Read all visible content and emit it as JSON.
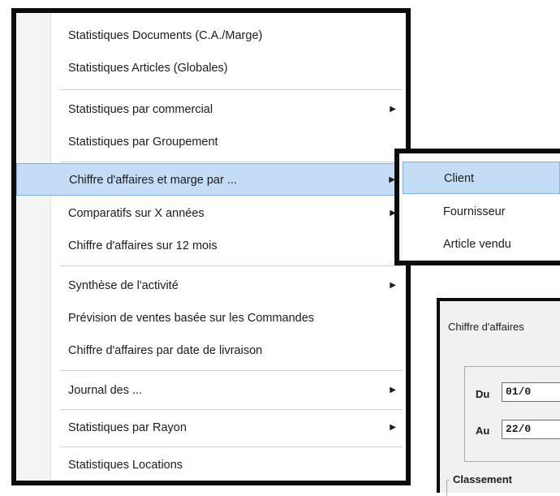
{
  "menu": {
    "items": [
      {
        "label": "Statistiques Documents  (C.A./Marge)",
        "submenu": false
      },
      {
        "label": "Statistiques Articles (Globales)",
        "submenu": false
      },
      {
        "label": "Statistiques par commercial",
        "submenu": true
      },
      {
        "label": "Statistiques par Groupement",
        "submenu": false
      },
      {
        "label": "Chiffre d'affaires et marge par ...",
        "submenu": true,
        "highlighted": true
      },
      {
        "label": "Comparatifs sur X années",
        "submenu": true
      },
      {
        "label": "Chiffre d'affaires sur 12 mois",
        "submenu": false
      },
      {
        "label": "Synthèse de l'activité",
        "submenu": true
      },
      {
        "label": "Prévision de ventes basée sur les Commandes",
        "submenu": false
      },
      {
        "label": "Chiffre d'affaires par date de livraison",
        "submenu": false
      },
      {
        "label": "Journal des ...",
        "submenu": true
      },
      {
        "label": "Statistiques par Rayon",
        "submenu": true
      },
      {
        "label": "Statistiques Locations",
        "submenu": false
      }
    ],
    "arrow_glyph": "▶"
  },
  "submenu": {
    "items": [
      {
        "label": "Client",
        "highlighted": true
      },
      {
        "label": "Fournisseur"
      },
      {
        "label": "Article vendu"
      }
    ]
  },
  "dialog": {
    "title": "Chiffre d'affaires",
    "du_label": "Du",
    "du_value": "01/0",
    "au_label": "Au",
    "au_value": "22/0",
    "classement_label": "Classement"
  },
  "colors": {
    "highlight_bg": "#c4dcf5",
    "highlight_border": "#7fb0e8",
    "frame": "#0c0c0c"
  }
}
